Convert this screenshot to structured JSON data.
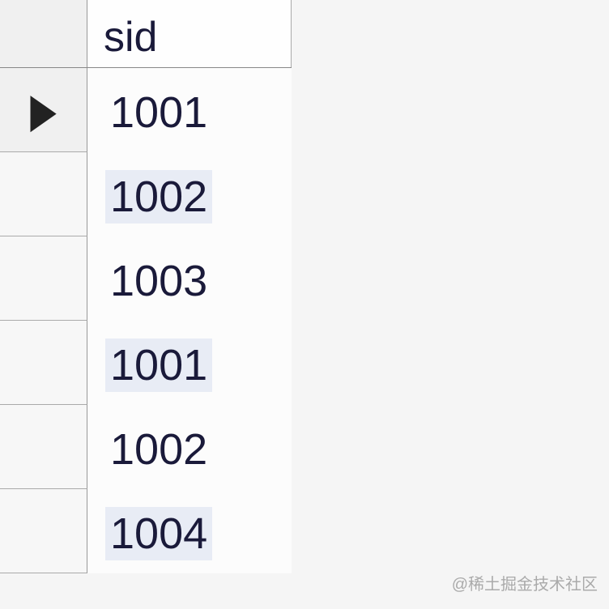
{
  "table": {
    "column_header": "sid",
    "rows": [
      {
        "value": "1001",
        "selected": true,
        "alt": false
      },
      {
        "value": "1002",
        "selected": false,
        "alt": true
      },
      {
        "value": "1003",
        "selected": false,
        "alt": false
      },
      {
        "value": "1001",
        "selected": false,
        "alt": true
      },
      {
        "value": "1002",
        "selected": false,
        "alt": false
      },
      {
        "value": "1004",
        "selected": false,
        "alt": true
      }
    ]
  },
  "watermark": "@稀土掘金技术社区"
}
